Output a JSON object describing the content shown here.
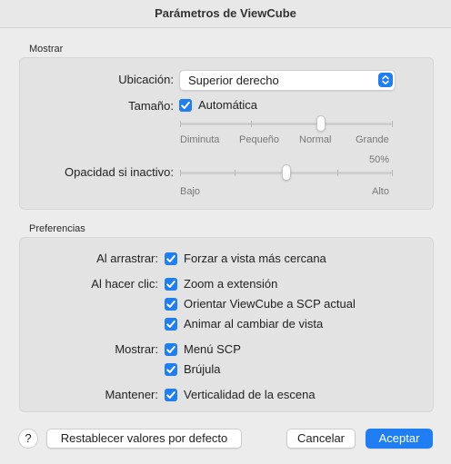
{
  "window": {
    "title": "Parámetros de ViewCube"
  },
  "mostrar": {
    "section_label": "Mostrar",
    "ubicacion": {
      "label": "Ubicación:",
      "value": "Superior derecho"
    },
    "tamano": {
      "label": "Tamaño:",
      "checkbox_label": "Automática",
      "checked": true,
      "ticks": [
        "Diminuta",
        "Pequeño",
        "Normal",
        "Grande"
      ],
      "selected_index": 2
    },
    "opacidad": {
      "label": "Opacidad si inactivo:",
      "value_text": "50%",
      "value": 0.5,
      "min_label": "Bajo",
      "max_label": "Alto"
    }
  },
  "preferencias": {
    "section_label": "Preferencias",
    "al_arrastrar": {
      "label": "Al arrastrar:",
      "options": [
        "Forzar a vista más cercana"
      ]
    },
    "al_hacer_clic": {
      "label": "Al hacer clic:",
      "options": [
        "Zoom a extensión",
        "Orientar ViewCube a SCP actual",
        "Animar al cambiar de vista"
      ]
    },
    "mostrar": {
      "label": "Mostrar:",
      "options": [
        "Menú SCP",
        "Brújula"
      ]
    },
    "mantener": {
      "label": "Mantener:",
      "options": [
        "Verticalidad de la escena"
      ]
    }
  },
  "footer": {
    "help": "?",
    "reset": "Restablecer valores por defecto",
    "cancel": "Cancelar",
    "accept": "Aceptar"
  },
  "colors": {
    "accent": "#1f7ef2",
    "window_bg": "#ececec",
    "group_bg": "#e3e3e3"
  }
}
